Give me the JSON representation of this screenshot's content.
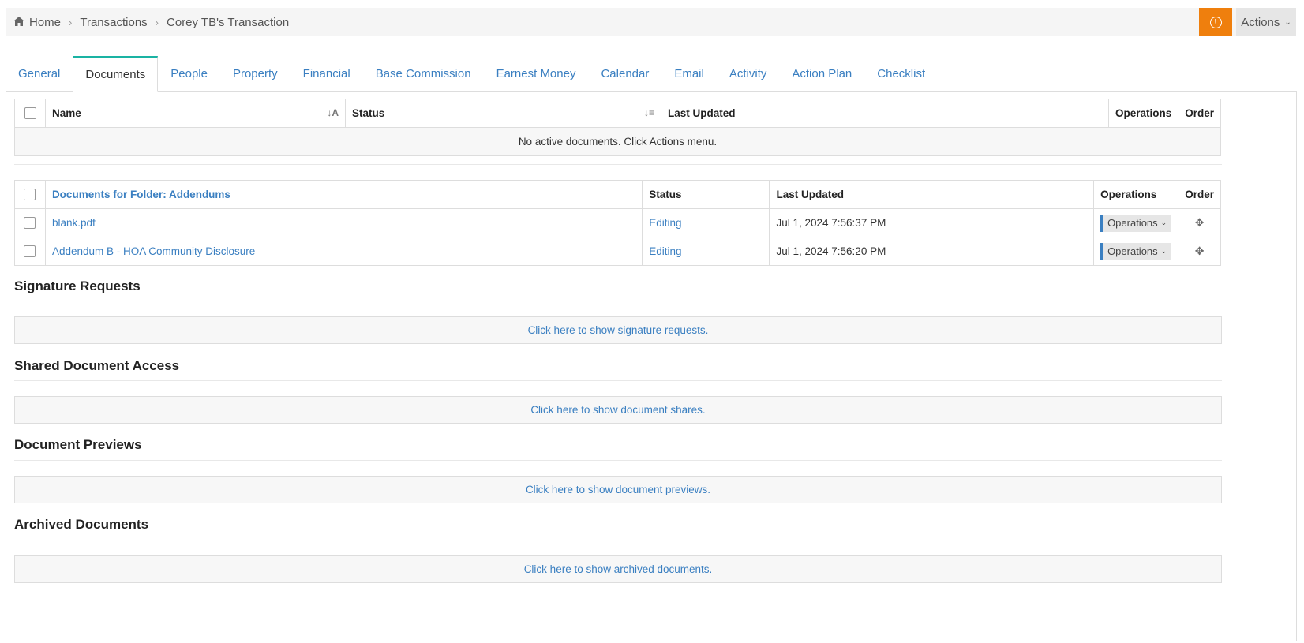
{
  "breadcrumb": {
    "home": "Home",
    "transactions": "Transactions",
    "current": "Corey TB's Transaction"
  },
  "header": {
    "actions_label": "Actions",
    "warning_glyph": "!"
  },
  "tabs": [
    {
      "label": "General"
    },
    {
      "label": "Documents",
      "active": true
    },
    {
      "label": "People"
    },
    {
      "label": "Property"
    },
    {
      "label": "Financial"
    },
    {
      "label": "Base Commission"
    },
    {
      "label": "Earnest Money"
    },
    {
      "label": "Calendar"
    },
    {
      "label": "Email"
    },
    {
      "label": "Activity"
    },
    {
      "label": "Action Plan"
    },
    {
      "label": "Checklist"
    }
  ],
  "active_docs": {
    "columns": {
      "name": "Name",
      "status": "Status",
      "last_updated": "Last Updated",
      "operations": "Operations",
      "order": "Order"
    },
    "empty_message": "No active documents. Click Actions menu."
  },
  "folder": {
    "title": "Documents for Folder: Addendums",
    "columns": {
      "status": "Status",
      "last_updated": "Last Updated",
      "operations": "Operations",
      "order": "Order"
    },
    "rows": [
      {
        "name": "blank.pdf",
        "status": "Editing",
        "last_updated": "Jul 1, 2024 7:56:37 PM",
        "operations": "Operations"
      },
      {
        "name": "Addendum B - HOA Community Disclosure",
        "status": "Editing",
        "last_updated": "Jul 1, 2024 7:56:20 PM",
        "operations": "Operations"
      }
    ]
  },
  "sections": {
    "signature": {
      "title": "Signature Requests",
      "link": "Click here to show signature requests."
    },
    "shared": {
      "title": "Shared Document Access",
      "link": "Click here to show document shares."
    },
    "previews": {
      "title": "Document Previews",
      "link": "Click here to show document previews."
    },
    "archived": {
      "title": "Archived Documents",
      "link": "Click here to show archived documents."
    }
  },
  "colors": {
    "accent": "#3a7fc1",
    "warning": "#ef7f0d",
    "active_tab": "#1ab3a3"
  }
}
